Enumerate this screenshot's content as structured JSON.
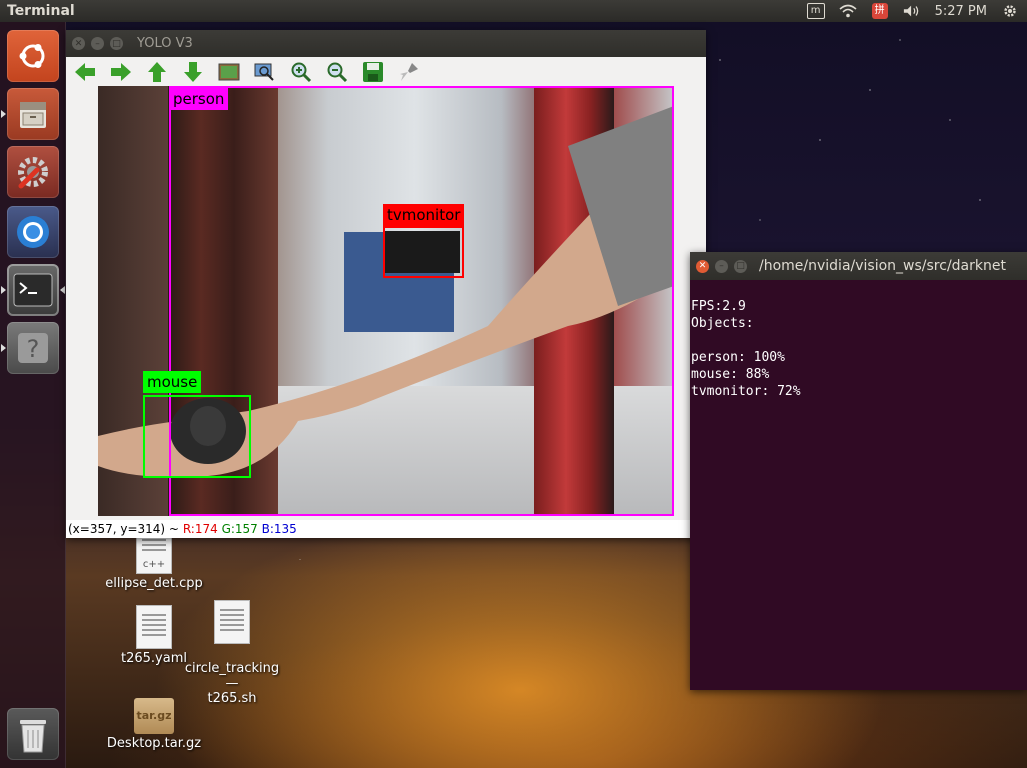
{
  "top_panel": {
    "app_title": "Terminal",
    "clock": "5:27 PM"
  },
  "launcher": {
    "items": [
      {
        "name": "ubuntu-dash",
        "icon": "ubuntu-logo-icon"
      },
      {
        "name": "files",
        "icon": "file-cabinet-icon"
      },
      {
        "name": "system-settings",
        "icon": "wrench-gear-icon"
      },
      {
        "name": "chromium",
        "icon": "chromium-icon"
      },
      {
        "name": "terminal",
        "icon": "terminal-icon"
      },
      {
        "name": "help",
        "icon": "question-icon"
      },
      {
        "name": "trash",
        "icon": "trash-icon"
      }
    ]
  },
  "desktop": {
    "icons": [
      {
        "label": "ellipse_det.cpp",
        "badge": "c++"
      },
      {
        "label": "t265.yaml"
      },
      {
        "label": "circle_tracking—\nt265.sh"
      },
      {
        "label": "Desktop.tar.gz",
        "badge": "tar.gz"
      }
    ]
  },
  "yolo_window": {
    "title": "YOLO V3",
    "toolbar": [
      "back-arrow-icon",
      "forward-arrow-icon",
      "up-arrow-icon",
      "down-arrow-icon",
      "image-icon",
      "zoom-fit-icon",
      "zoom-in-icon",
      "zoom-out-icon",
      "save-icon",
      "brush-icon"
    ],
    "detections": [
      {
        "label": "person",
        "color": "#ff00ff"
      },
      {
        "label": "tvmonitor",
        "color": "#ff0000"
      },
      {
        "label": "mouse",
        "color": "#00ff00"
      }
    ],
    "status": {
      "coords": "(x=357, y=314) ~",
      "r": "R:174",
      "g": "G:157",
      "b": "B:135"
    }
  },
  "terminal": {
    "title": "/home/nvidia/vision_ws/src/darknet",
    "fps": "FPS:2.9",
    "objects_header": "Objects:",
    "lines": [
      "person: 100%",
      "mouse: 88%",
      "tvmonitor: 72%"
    ]
  }
}
